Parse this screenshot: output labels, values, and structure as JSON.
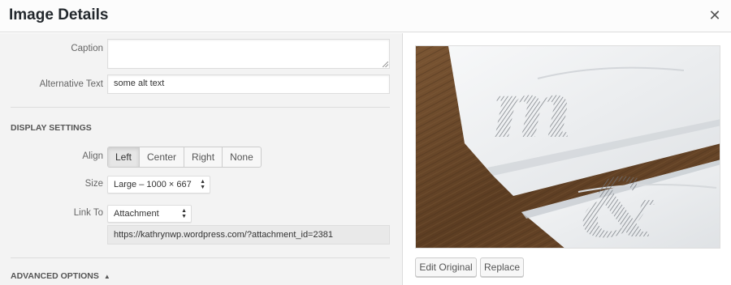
{
  "dialog": {
    "title": "Image Details"
  },
  "fields": {
    "caption_label": "Caption",
    "caption_value": "",
    "alt_label": "Alternative Text",
    "alt_value": "some alt text"
  },
  "display_settings": {
    "heading": "DISPLAY SETTINGS",
    "align_label": "Align",
    "align_options": [
      "Left",
      "Center",
      "Right",
      "None"
    ],
    "align_selected": "Left",
    "size_label": "Size",
    "size_value": "Large – 1000 × 667",
    "link_label": "Link To",
    "link_value": "Attachment Page",
    "link_url": "https://kathrynwp.wordpress.com/?attachment_id=2381"
  },
  "advanced": {
    "heading": "ADVANCED OPTIONS",
    "toggle_glyph": "▲"
  },
  "preview": {
    "overlay_letter_1": "m",
    "overlay_letter_2": "&",
    "edit_label": "Edit Original",
    "replace_label": "Replace"
  },
  "icons": {
    "close": "close-icon",
    "select_arrows": "up-down-arrows-icon",
    "collapse": "triangle-up-icon"
  },
  "colors": {
    "wood": "#6b4a2e",
    "towel": "#f1f2f3",
    "ink": "#7d8187"
  }
}
